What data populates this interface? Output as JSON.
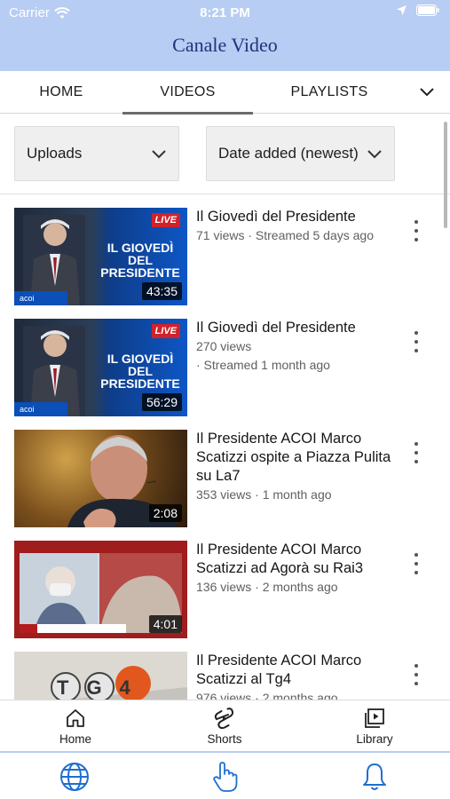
{
  "status_bar": {
    "carrier": "Carrier",
    "time": "8:21 PM",
    "icons": [
      "wifi-icon",
      "location-arrow-icon",
      "battery-icon"
    ]
  },
  "header": {
    "title": "Canale Video",
    "background": "#b7cdf3",
    "title_color": "#23327a"
  },
  "tabs": {
    "items": [
      {
        "label": "HOME"
      },
      {
        "label": "VIDEOS",
        "active": true
      },
      {
        "label": "PLAYLISTS"
      }
    ],
    "more_icon": "chevron-down-icon"
  },
  "filters": {
    "type": {
      "value": "Uploads"
    },
    "sort": {
      "value": "Date added (newest)"
    }
  },
  "videos": [
    {
      "title": "Il Giovedì del Presidente",
      "meta": "71 views · Streamed 5 days ago",
      "duration": "43:35",
      "thumb_title": "IL GIOVEDÌ DEL PRESIDENTE",
      "thumb_live": "LIVE",
      "thumb_logo": "acoi"
    },
    {
      "title": "Il Giovedì del Presidente",
      "meta_line1": "270 views",
      "meta_line2": "· Streamed 1 month ago",
      "duration": "56:29",
      "thumb_title": "IL GIOVEDÌ DEL PRESIDENTE",
      "thumb_live": "LIVE",
      "thumb_logo": "acoi"
    },
    {
      "title": "Il Presidente ACOI Marco Scatizzi ospite a Piazza Pulita su La7",
      "meta": "353 views · 1 month ago",
      "duration": "2:08"
    },
    {
      "title": "Il Presidente ACOI Marco Scatizzi ad Agorà su Rai3",
      "meta": "136 views · 2 months ago",
      "duration": "4:01"
    },
    {
      "title": "Il Presidente ACOI Marco Scatizzi al Tg4",
      "meta": "976 views · 2 months ago",
      "thumb_label": "TG4"
    }
  ],
  "bottom_nav": [
    {
      "label": "Home",
      "icon": "home-icon"
    },
    {
      "label": "Shorts",
      "icon": "shorts-icon"
    },
    {
      "label": "Library",
      "icon": "library-icon"
    }
  ],
  "app_bar": [
    {
      "icon": "globe-icon"
    },
    {
      "icon": "hand-pointer-icon"
    },
    {
      "icon": "bell-icon"
    }
  ],
  "colors": {
    "accent_blue": "#1f6fd1",
    "tab_indicator": "#6b6b6b"
  }
}
